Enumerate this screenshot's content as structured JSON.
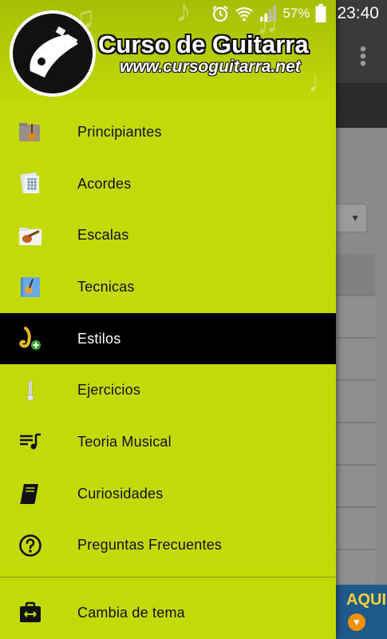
{
  "statusbar": {
    "battery_percent": "57%",
    "time": "23:40",
    "icons": [
      "alarm-icon",
      "wifi-icon",
      "signal-icon",
      "battery-icon"
    ]
  },
  "drawer": {
    "brand_title": "Curso de Guitarra",
    "brand_url": "www.cursoguitarra.net",
    "items": [
      {
        "label": "Principiantes",
        "icon": "guitar-folder-icon"
      },
      {
        "label": "Acordes",
        "icon": "chord-sheet-icon"
      },
      {
        "label": "Escalas",
        "icon": "guitar-folder-icon"
      },
      {
        "label": "Tecnicas",
        "icon": "guitar-book-icon"
      },
      {
        "label": "Estilos",
        "icon": "saxophone-add-icon",
        "active": true
      },
      {
        "label": "Ejercicios",
        "icon": "guitar-neck-icon"
      },
      {
        "label": "Teoria Musical",
        "icon": "music-list-icon"
      },
      {
        "label": "Curiosidades",
        "icon": "book-icon"
      },
      {
        "label": "Preguntas Frecuentes",
        "icon": "help-circle-icon"
      }
    ],
    "footer": {
      "label": "Cambia de tema",
      "icon": "swap-case-icon"
    }
  },
  "background": {
    "ad_text": "AQUI"
  },
  "colors": {
    "drawer_bg": "#c3da08",
    "active_bg": "#000000",
    "topbar": "#3a3a3a"
  }
}
